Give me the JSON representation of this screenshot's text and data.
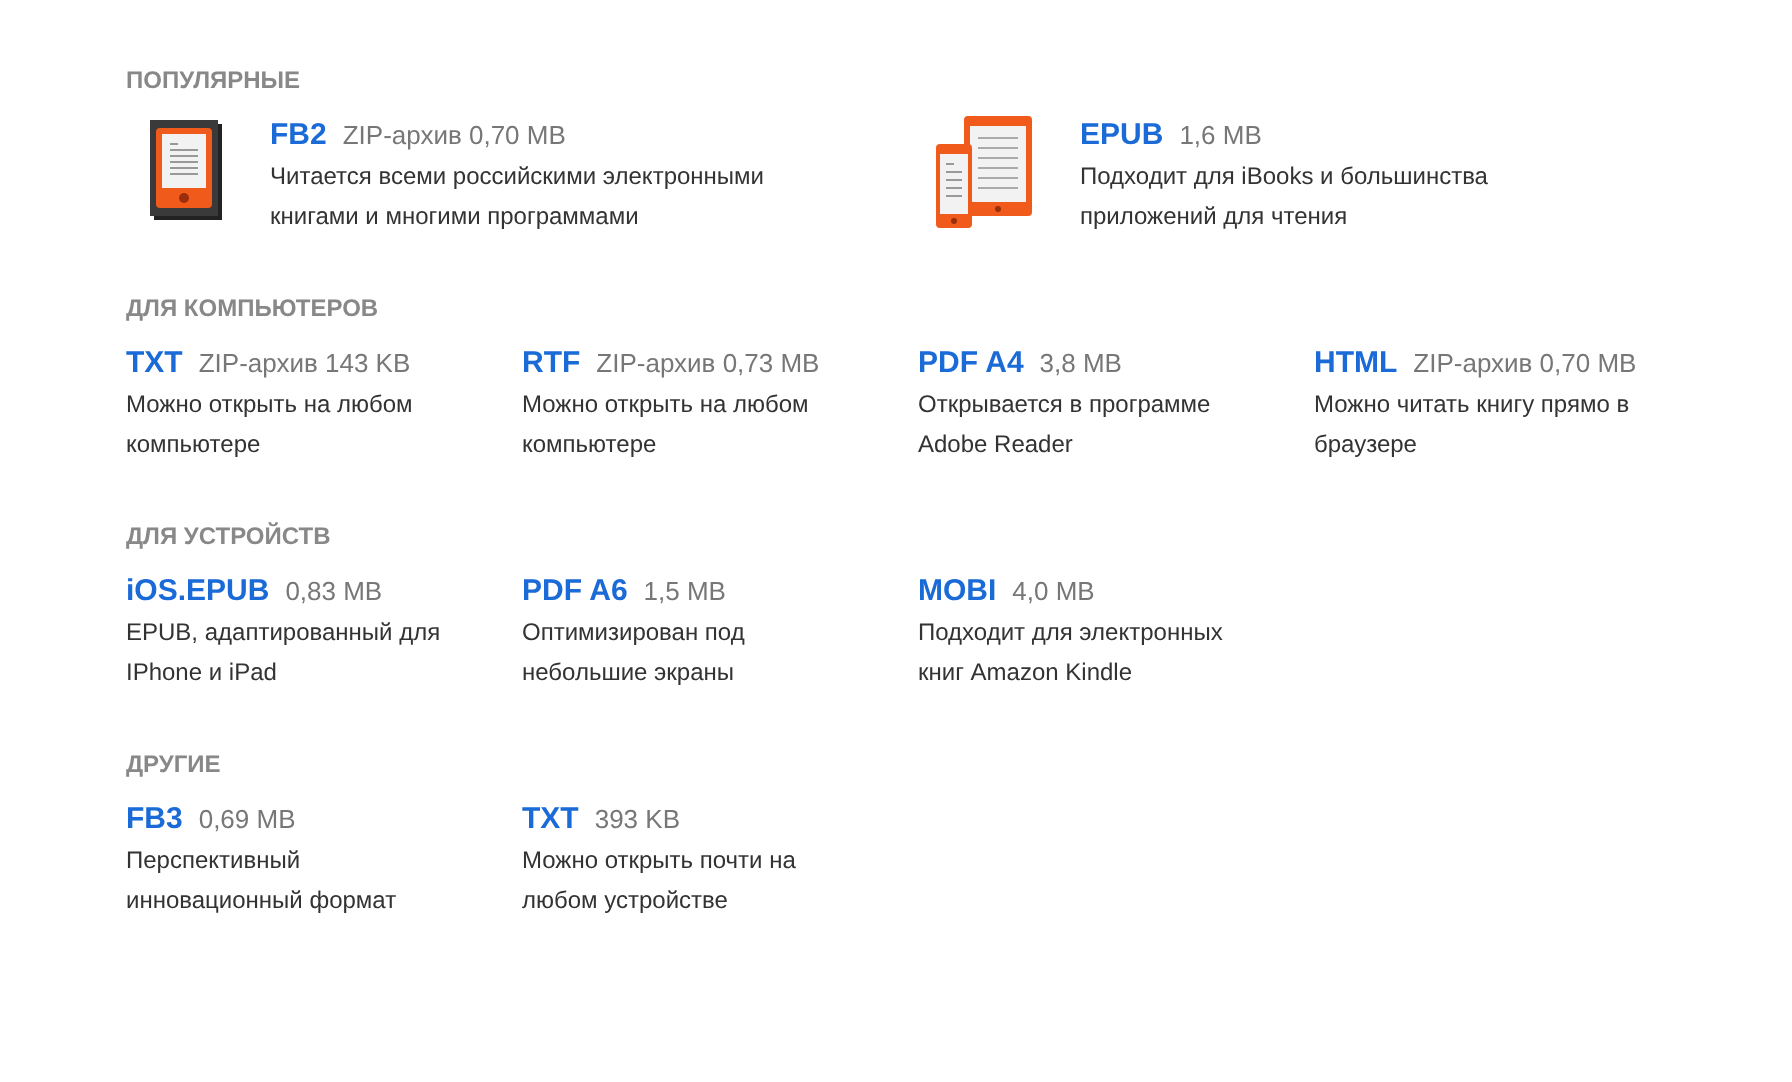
{
  "sections": [
    {
      "title": "ПОПУЛЯРНЫЕ",
      "kind": "featured",
      "items": [
        {
          "name": "FB2",
          "meta": "ZIP-архив 0,70 MB",
          "description": "Читается всеми российскими электронными книгами и многими программами",
          "kind": "reader"
        },
        {
          "name": "EPUB",
          "meta": "1,6 MB",
          "description": "Подходит для iBooks и большинства приложений для чтения",
          "kind": "devices"
        }
      ]
    },
    {
      "title": "ДЛЯ КОМПЬЮТЕРОВ",
      "kind": "grid",
      "items": [
        {
          "name": "TXT",
          "meta": "ZIP-архив 143 KB",
          "description": "Можно открыть на любом компьютере"
        },
        {
          "name": "RTF",
          "meta": "ZIP-архив 0,73 MB",
          "description": "Можно открыть на любом компьютере"
        },
        {
          "name": "PDF A4",
          "meta": "3,8 MB",
          "description": "Открывается в программе Adobe Reader"
        },
        {
          "name": "HTML",
          "meta": "ZIP-архив 0,70 MB",
          "description": "Можно читать книгу прямо в браузере"
        }
      ]
    },
    {
      "title": "ДЛЯ УСТРОЙСТВ",
      "kind": "grid",
      "items": [
        {
          "name": "iOS.EPUB",
          "meta": "0,83 MB",
          "description": "EPUB, адаптированный для IPhone и iPad"
        },
        {
          "name": "PDF A6",
          "meta": "1,5 MB",
          "description": "Оптимизирован под небольшие экраны"
        },
        {
          "name": "MOBI",
          "meta": "4,0 MB",
          "description": "Подходит для электронных книг Amazon Kindle"
        }
      ]
    },
    {
      "title": "ДРУГИЕ",
      "kind": "grid",
      "items": [
        {
          "name": "FB3",
          "meta": "0,69 MB",
          "description": "Перспективный инновационный формат"
        },
        {
          "name": "TXT",
          "meta": "393 KB",
          "description": "Можно открыть почти на любом устройстве"
        }
      ]
    }
  ]
}
